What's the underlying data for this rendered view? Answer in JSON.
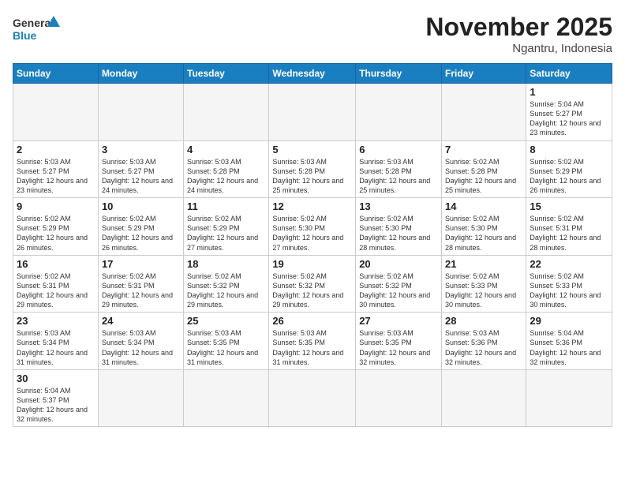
{
  "header": {
    "logo_general": "General",
    "logo_blue": "Blue",
    "month_title": "November 2025",
    "location": "Ngantru, Indonesia"
  },
  "weekdays": [
    "Sunday",
    "Monday",
    "Tuesday",
    "Wednesday",
    "Thursday",
    "Friday",
    "Saturday"
  ],
  "weeks": [
    [
      {
        "day": "",
        "info": ""
      },
      {
        "day": "",
        "info": ""
      },
      {
        "day": "",
        "info": ""
      },
      {
        "day": "",
        "info": ""
      },
      {
        "day": "",
        "info": ""
      },
      {
        "day": "",
        "info": ""
      },
      {
        "day": "1",
        "info": "Sunrise: 5:04 AM\nSunset: 5:27 PM\nDaylight: 12 hours\nand 23 minutes."
      }
    ],
    [
      {
        "day": "2",
        "info": "Sunrise: 5:03 AM\nSunset: 5:27 PM\nDaylight: 12 hours\nand 23 minutes."
      },
      {
        "day": "3",
        "info": "Sunrise: 5:03 AM\nSunset: 5:27 PM\nDaylight: 12 hours\nand 24 minutes."
      },
      {
        "day": "4",
        "info": "Sunrise: 5:03 AM\nSunset: 5:28 PM\nDaylight: 12 hours\nand 24 minutes."
      },
      {
        "day": "5",
        "info": "Sunrise: 5:03 AM\nSunset: 5:28 PM\nDaylight: 12 hours\nand 25 minutes."
      },
      {
        "day": "6",
        "info": "Sunrise: 5:03 AM\nSunset: 5:28 PM\nDaylight: 12 hours\nand 25 minutes."
      },
      {
        "day": "7",
        "info": "Sunrise: 5:02 AM\nSunset: 5:28 PM\nDaylight: 12 hours\nand 25 minutes."
      },
      {
        "day": "8",
        "info": "Sunrise: 5:02 AM\nSunset: 5:29 PM\nDaylight: 12 hours\nand 26 minutes."
      }
    ],
    [
      {
        "day": "9",
        "info": "Sunrise: 5:02 AM\nSunset: 5:29 PM\nDaylight: 12 hours\nand 26 minutes."
      },
      {
        "day": "10",
        "info": "Sunrise: 5:02 AM\nSunset: 5:29 PM\nDaylight: 12 hours\nand 26 minutes."
      },
      {
        "day": "11",
        "info": "Sunrise: 5:02 AM\nSunset: 5:29 PM\nDaylight: 12 hours\nand 27 minutes."
      },
      {
        "day": "12",
        "info": "Sunrise: 5:02 AM\nSunset: 5:30 PM\nDaylight: 12 hours\nand 27 minutes."
      },
      {
        "day": "13",
        "info": "Sunrise: 5:02 AM\nSunset: 5:30 PM\nDaylight: 12 hours\nand 28 minutes."
      },
      {
        "day": "14",
        "info": "Sunrise: 5:02 AM\nSunset: 5:30 PM\nDaylight: 12 hours\nand 28 minutes."
      },
      {
        "day": "15",
        "info": "Sunrise: 5:02 AM\nSunset: 5:31 PM\nDaylight: 12 hours\nand 28 minutes."
      }
    ],
    [
      {
        "day": "16",
        "info": "Sunrise: 5:02 AM\nSunset: 5:31 PM\nDaylight: 12 hours\nand 29 minutes."
      },
      {
        "day": "17",
        "info": "Sunrise: 5:02 AM\nSunset: 5:31 PM\nDaylight: 12 hours\nand 29 minutes."
      },
      {
        "day": "18",
        "info": "Sunrise: 5:02 AM\nSunset: 5:32 PM\nDaylight: 12 hours\nand 29 minutes."
      },
      {
        "day": "19",
        "info": "Sunrise: 5:02 AM\nSunset: 5:32 PM\nDaylight: 12 hours\nand 29 minutes."
      },
      {
        "day": "20",
        "info": "Sunrise: 5:02 AM\nSunset: 5:32 PM\nDaylight: 12 hours\nand 30 minutes."
      },
      {
        "day": "21",
        "info": "Sunrise: 5:02 AM\nSunset: 5:33 PM\nDaylight: 12 hours\nand 30 minutes."
      },
      {
        "day": "22",
        "info": "Sunrise: 5:02 AM\nSunset: 5:33 PM\nDaylight: 12 hours\nand 30 minutes."
      }
    ],
    [
      {
        "day": "23",
        "info": "Sunrise: 5:03 AM\nSunset: 5:34 PM\nDaylight: 12 hours\nand 31 minutes."
      },
      {
        "day": "24",
        "info": "Sunrise: 5:03 AM\nSunset: 5:34 PM\nDaylight: 12 hours\nand 31 minutes."
      },
      {
        "day": "25",
        "info": "Sunrise: 5:03 AM\nSunset: 5:35 PM\nDaylight: 12 hours\nand 31 minutes."
      },
      {
        "day": "26",
        "info": "Sunrise: 5:03 AM\nSunset: 5:35 PM\nDaylight: 12 hours\nand 31 minutes."
      },
      {
        "day": "27",
        "info": "Sunrise: 5:03 AM\nSunset: 5:35 PM\nDaylight: 12 hours\nand 32 minutes."
      },
      {
        "day": "28",
        "info": "Sunrise: 5:03 AM\nSunset: 5:36 PM\nDaylight: 12 hours\nand 32 minutes."
      },
      {
        "day": "29",
        "info": "Sunrise: 5:04 AM\nSunset: 5:36 PM\nDaylight: 12 hours\nand 32 minutes."
      }
    ],
    [
      {
        "day": "30",
        "info": "Sunrise: 5:04 AM\nSunset: 5:37 PM\nDaylight: 12 hours\nand 32 minutes."
      },
      {
        "day": "",
        "info": ""
      },
      {
        "day": "",
        "info": ""
      },
      {
        "day": "",
        "info": ""
      },
      {
        "day": "",
        "info": ""
      },
      {
        "day": "",
        "info": ""
      },
      {
        "day": "",
        "info": ""
      }
    ]
  ]
}
